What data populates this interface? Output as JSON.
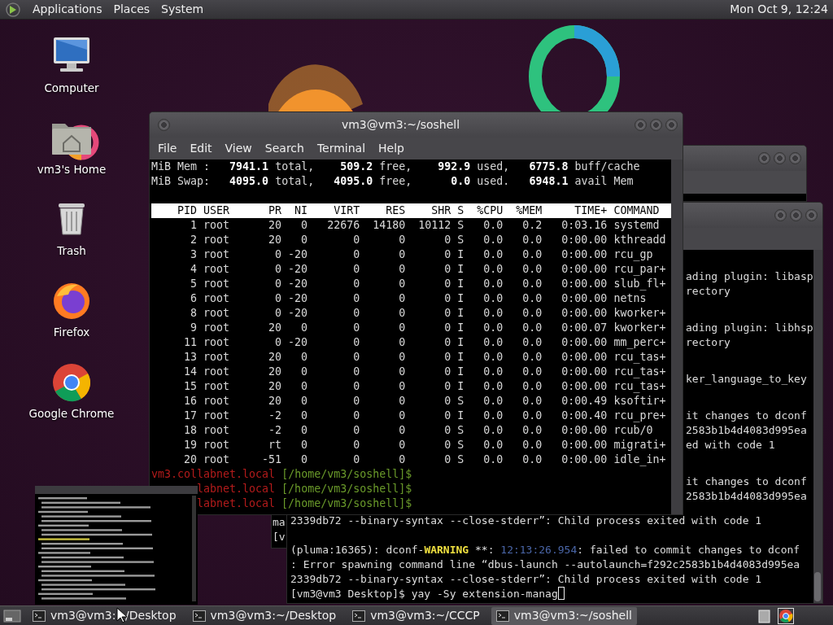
{
  "top_panel": {
    "menus": [
      "Applications",
      "Places",
      "System"
    ],
    "clock": "Mon Oct 9, 12:24"
  },
  "desktop_icons": [
    {
      "label": "Computer",
      "kind": "computer"
    },
    {
      "label": "vm3's Home",
      "kind": "home"
    },
    {
      "label": "Trash",
      "kind": "trash"
    },
    {
      "label": "Firefox",
      "kind": "firefox"
    },
    {
      "label": "Google Chrome",
      "kind": "chrome"
    }
  ],
  "back_terminal": {
    "clipped_groups": [
      [
        "ading plugin: libasp",
        "rectory"
      ],
      [
        "ading plugin: libhsp",
        "rectory"
      ],
      [
        "ker_language_to_key"
      ],
      [
        "it changes to dconf",
        "2583b1b4d4083d995ea",
        "ed with code 1"
      ],
      [
        "it changes to dconf",
        "2583b1b4d4083d995ea"
      ]
    ],
    "blocks": [
      [
        [
          {
            "text": "2339db72 --binary-syntax --close-stderr”: Child process exited with code 1"
          }
        ]
      ],
      [
        [
          {
            "text": "(pluma:16365): dconf-"
          },
          {
            "text": "WARNING",
            "kind": "warning"
          },
          {
            "text": " **: "
          },
          {
            "text": "12:13:26.954",
            "kind": "timestamp"
          },
          {
            "text": ": failed to commit changes to dconf"
          }
        ],
        [
          {
            "text": ": Error spawning command line “dbus-launch --autolaunch=f292c2583b1b4d4083d995ea"
          }
        ],
        [
          {
            "text": "2339db72 --binary-syntax --close-stderr”: Child process exited with code 1"
          }
        ],
        [
          {
            "text": "[vm3@vm3 Desktop]$ yay -Sy extension-manag"
          }
        ]
      ]
    ]
  },
  "side_window": {
    "lines": [
      "ma",
      "[v"
    ]
  },
  "terminal": {
    "title": "vm3@vm3:~/soshell",
    "menu": [
      "File",
      "Edit",
      "View",
      "Search",
      "Terminal",
      "Help"
    ],
    "summary": [
      "MiB Mem :   **7941.1** total,    **509.2** free,    **992.9** used,   **6775.8** buff/cache",
      "MiB Swap:   **4095.0** total,   **4095.0** free,      **0.0** used.   **6948.1** avail Mem"
    ],
    "columns": [
      "PID",
      "USER",
      "PR",
      "NI",
      "VIRT",
      "RES",
      "SHR",
      "S",
      "%CPU",
      "%MEM",
      "TIME+",
      "COMMAND"
    ],
    "processes": [
      [
        "1",
        "root",
        "20",
        "0",
        "22676",
        "14180",
        "10112",
        "S",
        "0.0",
        "0.2",
        "0:03.16",
        "systemd"
      ],
      [
        "2",
        "root",
        "20",
        "0",
        "0",
        "0",
        "0",
        "S",
        "0.0",
        "0.0",
        "0:00.00",
        "kthreadd"
      ],
      [
        "3",
        "root",
        "0",
        "-20",
        "0",
        "0",
        "0",
        "I",
        "0.0",
        "0.0",
        "0:00.00",
        "rcu_gp"
      ],
      [
        "4",
        "root",
        "0",
        "-20",
        "0",
        "0",
        "0",
        "I",
        "0.0",
        "0.0",
        "0:00.00",
        "rcu_par+"
      ],
      [
        "5",
        "root",
        "0",
        "-20",
        "0",
        "0",
        "0",
        "I",
        "0.0",
        "0.0",
        "0:00.00",
        "slub_fl+"
      ],
      [
        "6",
        "root",
        "0",
        "-20",
        "0",
        "0",
        "0",
        "I",
        "0.0",
        "0.0",
        "0:00.00",
        "netns"
      ],
      [
        "8",
        "root",
        "0",
        "-20",
        "0",
        "0",
        "0",
        "I",
        "0.0",
        "0.0",
        "0:00.00",
        "kworker+"
      ],
      [
        "9",
        "root",
        "20",
        "0",
        "0",
        "0",
        "0",
        "I",
        "0.0",
        "0.0",
        "0:00.07",
        "kworker+"
      ],
      [
        "11",
        "root",
        "0",
        "-20",
        "0",
        "0",
        "0",
        "I",
        "0.0",
        "0.0",
        "0:00.00",
        "mm_perc+"
      ],
      [
        "13",
        "root",
        "20",
        "0",
        "0",
        "0",
        "0",
        "I",
        "0.0",
        "0.0",
        "0:00.00",
        "rcu_tas+"
      ],
      [
        "14",
        "root",
        "20",
        "0",
        "0",
        "0",
        "0",
        "I",
        "0.0",
        "0.0",
        "0:00.00",
        "rcu_tas+"
      ],
      [
        "15",
        "root",
        "20",
        "0",
        "0",
        "0",
        "0",
        "I",
        "0.0",
        "0.0",
        "0:00.00",
        "rcu_tas+"
      ],
      [
        "16",
        "root",
        "20",
        "0",
        "0",
        "0",
        "0",
        "S",
        "0.0",
        "0.0",
        "0:00.49",
        "ksoftir+"
      ],
      [
        "17",
        "root",
        "-2",
        "0",
        "0",
        "0",
        "0",
        "I",
        "0.0",
        "0.0",
        "0:00.40",
        "rcu_pre+"
      ],
      [
        "18",
        "root",
        "-2",
        "0",
        "0",
        "0",
        "0",
        "S",
        "0.0",
        "0.0",
        "0:00.00",
        "rcub/0"
      ],
      [
        "19",
        "root",
        "rt",
        "0",
        "0",
        "0",
        "0",
        "S",
        "0.0",
        "0.0",
        "0:00.00",
        "migrati+"
      ],
      [
        "20",
        "root",
        "-51",
        "0",
        "0",
        "0",
        "0",
        "S",
        "0.0",
        "0.0",
        "0:00.00",
        "idle_in+"
      ]
    ],
    "prompts": [
      {
        "host": "vm3.collabnet.local",
        "path": "[/home/vm3/soshell]$"
      },
      {
        "host": "labnet.local",
        "path": "[/home/vm3/soshell]$"
      },
      {
        "host": "labnet.local",
        "path": "[/home/vm3/soshell]$"
      }
    ]
  },
  "taskbar": {
    "items": [
      {
        "label": "vm3@vm3:~/Desktop",
        "selected": false
      },
      {
        "label": "vm3@vm3:~/Desktop",
        "selected": false
      },
      {
        "label": "vm3@vm3:~/CCCP",
        "selected": false
      },
      {
        "label": "vm3@vm3:~/soshell",
        "selected": true
      }
    ]
  }
}
